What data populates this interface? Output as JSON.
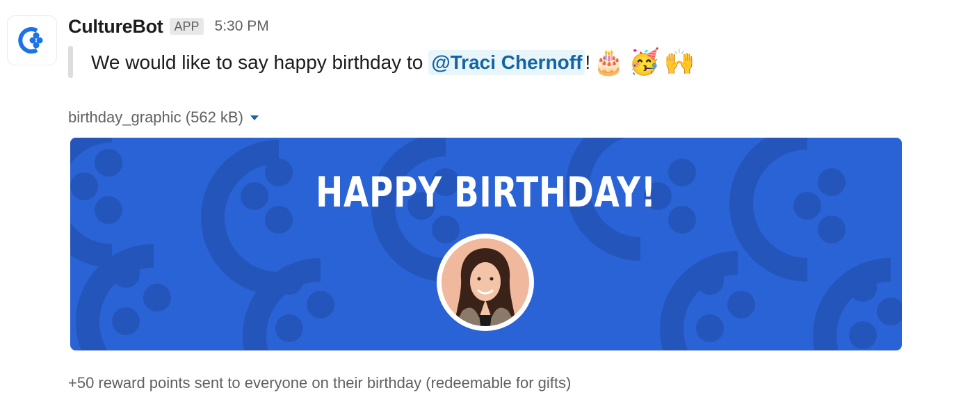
{
  "bot": {
    "name": "CultureBot",
    "badge": "APP",
    "time": "5:30 PM"
  },
  "message": {
    "text_before": "We would like to say happy birthday to",
    "mention": "@Traci Chernoff",
    "text_after": "!",
    "emojis": [
      "🎂",
      "🥳",
      "🙌"
    ]
  },
  "attachment": {
    "file_label": "birthday_graphic (562 kB)",
    "graphic_title": "HAPPY BIRTHDAY!",
    "background_color": "#2a63d6"
  },
  "footer": "+50 reward points sent to everyone on their birthday (redeemable for gifts)",
  "colors": {
    "brand_blue": "#1a73e8",
    "mention_bg": "#e8f5fa",
    "mention_text": "#1264a3"
  }
}
